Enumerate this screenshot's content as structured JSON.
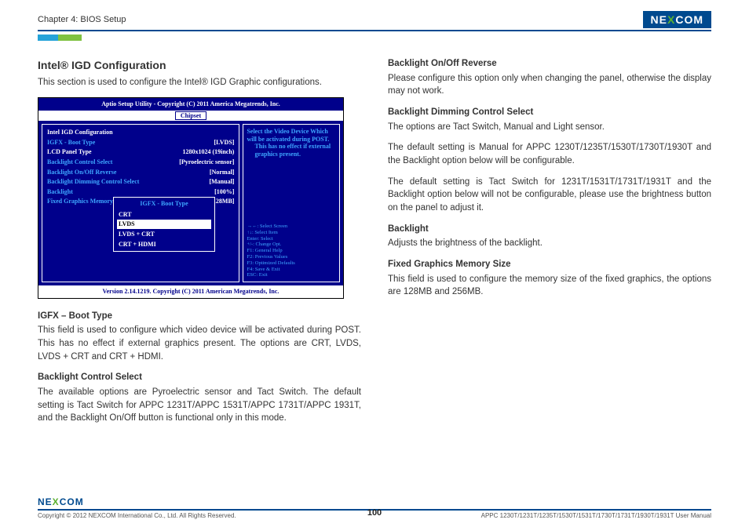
{
  "header": {
    "chapter": "Chapter 4: BIOS Setup",
    "brand": "NE COM",
    "brand_pre": "NE",
    "brand_x": "X",
    "brand_post": "COM"
  },
  "left": {
    "title": "Intel® IGD Configuration",
    "intro": "This section is used to configure the Intel® IGD Graphic configurations.",
    "sec1_h": "IGFX – Boot Type",
    "sec1_p": "This field is used to configure which video device will be activated during POST. This has no effect if external graphics present. The options are CRT, LVDS, LVDS + CRT and CRT + HDMI.",
    "sec2_h": "Backlight Control Select",
    "sec2_p": "The available options are Pyroelectric sensor and Tact Switch. The default setting is Tact Switch for APPC 1231T/APPC 1531T/APPC 1731T/APPC 1931T, and the Backlight On/Off button is functional only in this mode."
  },
  "right": {
    "r1_h": "Backlight On/Off Reverse",
    "r1_p": "Please configure this option only when changing the panel, otherwise the display may not work.",
    "r2_h": "Backlight Dimming Control Select",
    "r2_p": "The options are Tact Switch, Manual and Light sensor.",
    "r3_p": "The default setting is Manual for APPC 1230T/1235T/1530T/1730T/1930T and the Backlight option below will be configurable.",
    "r4_p": "The default setting is Tact Switch for 1231T/1531T/1731T/1931T and the Backlight option below will not be configurable, please use the brightness button on the panel to adjust it.",
    "r5_h": "Backlight",
    "r5_p": "Adjusts the brightness of the backlight.",
    "r6_h": "Fixed Graphics Memory Size",
    "r6_p": "This field is used to configure the memory size of the fixed graphics, the options are 128MB and 256MB."
  },
  "bios": {
    "top": "Aptio Setup Utility - Copyright (C) 2011 America Megatrends, Inc.",
    "tab": "Chipset",
    "section": "Intel IGD Configuration",
    "rows": [
      {
        "k": "IGFX - Boot Type",
        "v": "[LVDS]"
      },
      {
        "k": "LCD Panel Type",
        "v": "1280x1024 (19inch)"
      },
      {
        "k": "Backlight Control Select",
        "v": "[Pyroelectric sensor]"
      },
      {
        "k": "Backlight On/Off Reverse",
        "v": "[Normal]"
      },
      {
        "k": "Backlight Dimming Control Select",
        "v": "[Manual]"
      },
      {
        "k": "Backlight",
        "v": "[100%]"
      },
      {
        "k": "Fixed Graphics Memory Size",
        "v": "[128MB]"
      }
    ],
    "popup_title": "IGFX - Boot Type",
    "popup_opts": [
      "CRT",
      "LVDS",
      "LVDS + CRT",
      "CRT + HDMI"
    ],
    "popup_selected": "LVDS",
    "help1": "Select the Video Device Which will be activated during POST.",
    "help2": "This has no effect if external graphics present.",
    "keys": [
      "→←: Select Screen",
      "↑↓: Select Item",
      "Enter: Select",
      "+/-: Change Opt.",
      "F1: General Help",
      "F2: Previous Values",
      "F3: Optimized Defaults",
      "F4: Save & Exit",
      "ESC: Exit"
    ],
    "bottom": "Version 2.14.1219. Copyright (C) 2011 American Megatrends, Inc."
  },
  "footer": {
    "copyright": "Copyright © 2012 NEXCOM International Co., Ltd. All Rights Reserved.",
    "page": "100",
    "doc": "APPC 1230T/1231T/1235T/1530T/1531T/1730T/1731T/1930T/1931T User Manual"
  }
}
